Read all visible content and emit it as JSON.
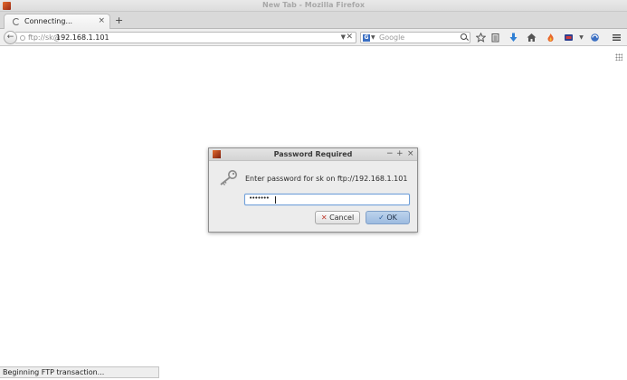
{
  "window": {
    "title": "New Tab - Mozilla Firefox"
  },
  "tabs": [
    {
      "label": "Connecting...",
      "close": "×"
    }
  ],
  "new_tab": "+",
  "navbar": {
    "back": "←",
    "url_scheme": "ftp://sk@",
    "url_host": "192.168.1.101",
    "url_dropdown": "▼",
    "url_stop": "✕",
    "search_placeholder": "Google",
    "search_engine_letter": "G",
    "search_engine_dropdown": "▼",
    "toolbar_icons": [
      "star-icon",
      "reading-list-icon",
      "download-icon",
      "home-icon",
      "extension-fire-icon",
      "extension-badge-icon",
      "extension-dropdown-icon",
      "sync-icon",
      "menu-icon"
    ]
  },
  "dialog": {
    "title": "Password Required",
    "minimize": "−",
    "maximize": "+",
    "close": "×",
    "message": "Enter password for sk on ftp://192.168.1.101",
    "password_mask": "•••••••",
    "cancel_label": "Cancel",
    "ok_label": "OK"
  },
  "status": {
    "text": "Beginning FTP transaction..."
  }
}
